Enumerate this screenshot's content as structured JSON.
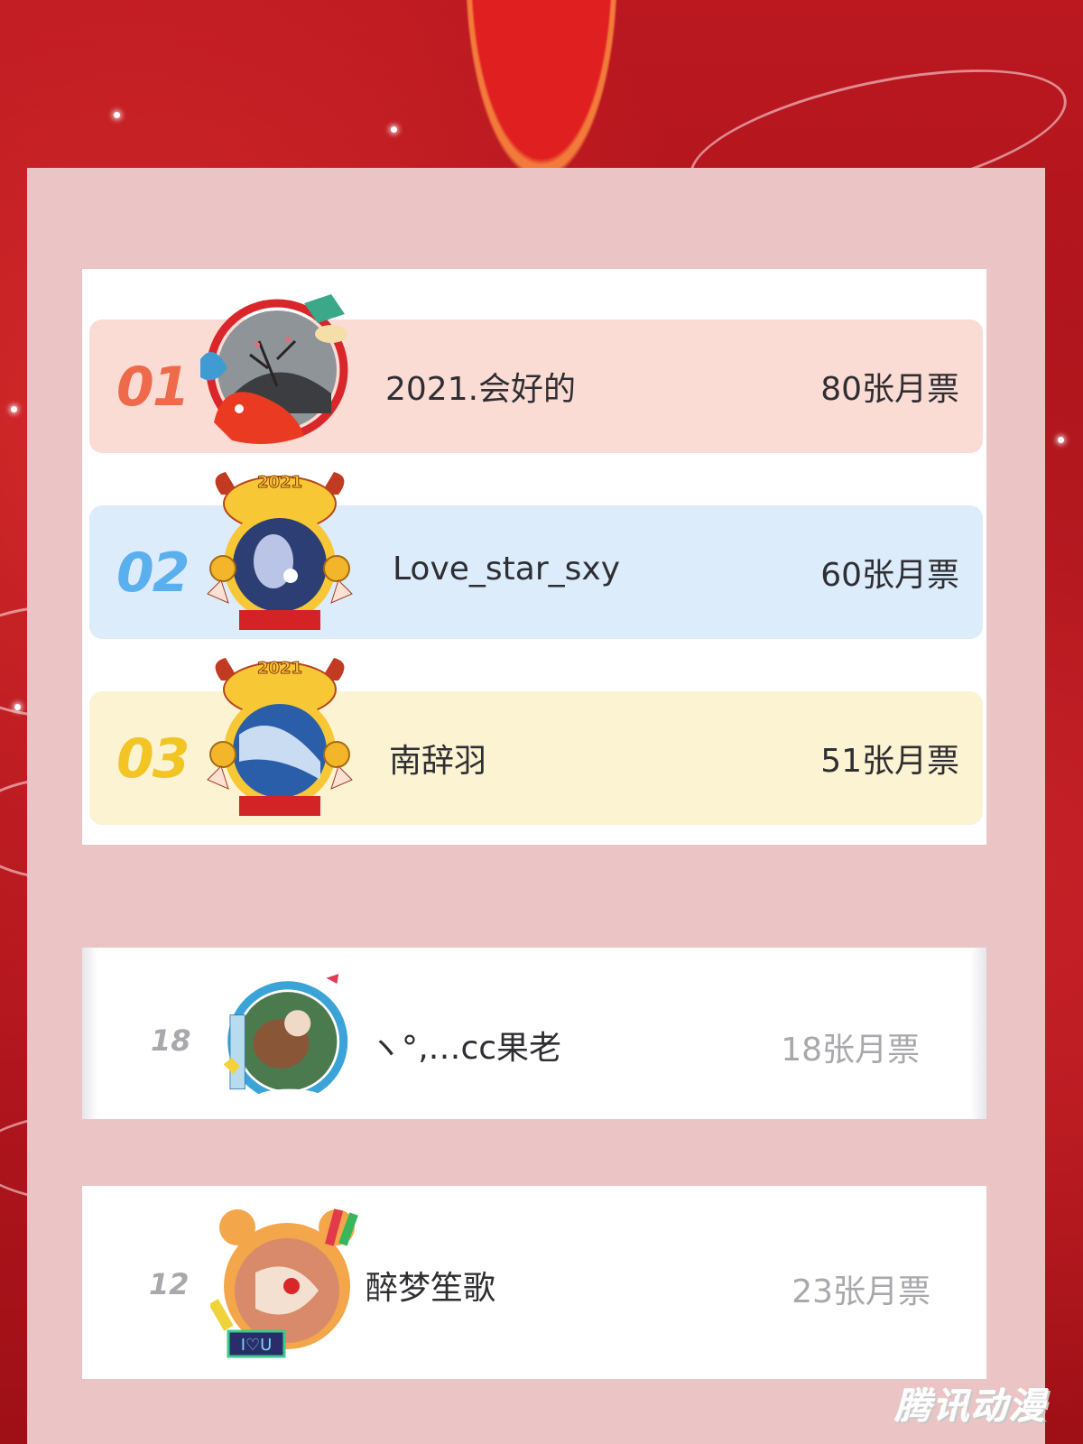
{
  "top_ranks": [
    {
      "rank": "01",
      "name": "2021.会好的",
      "tickets": "80张月票",
      "rank_color": "#ee6a4a",
      "row_color": "#fbdcd5"
    },
    {
      "rank": "02",
      "name": "Love_star_sxy",
      "tickets": "60张月票",
      "rank_color": "#5ab0ee",
      "row_color": "#dcecfb"
    },
    {
      "rank": "03",
      "name": "南辞羽",
      "tickets": "51张月票",
      "rank_color": "#f2c524",
      "row_color": "#fcf3d2"
    }
  ],
  "other_ranks": [
    {
      "rank": "18",
      "name": "ヽ°‚…cc果老",
      "tickets": "18张月票"
    },
    {
      "rank": "12",
      "name": "醉梦笙歌",
      "tickets": "23张月票"
    }
  ],
  "avatar_badge_text": "2021",
  "frame_text": "I♡U",
  "watermark": "腾讯动漫"
}
